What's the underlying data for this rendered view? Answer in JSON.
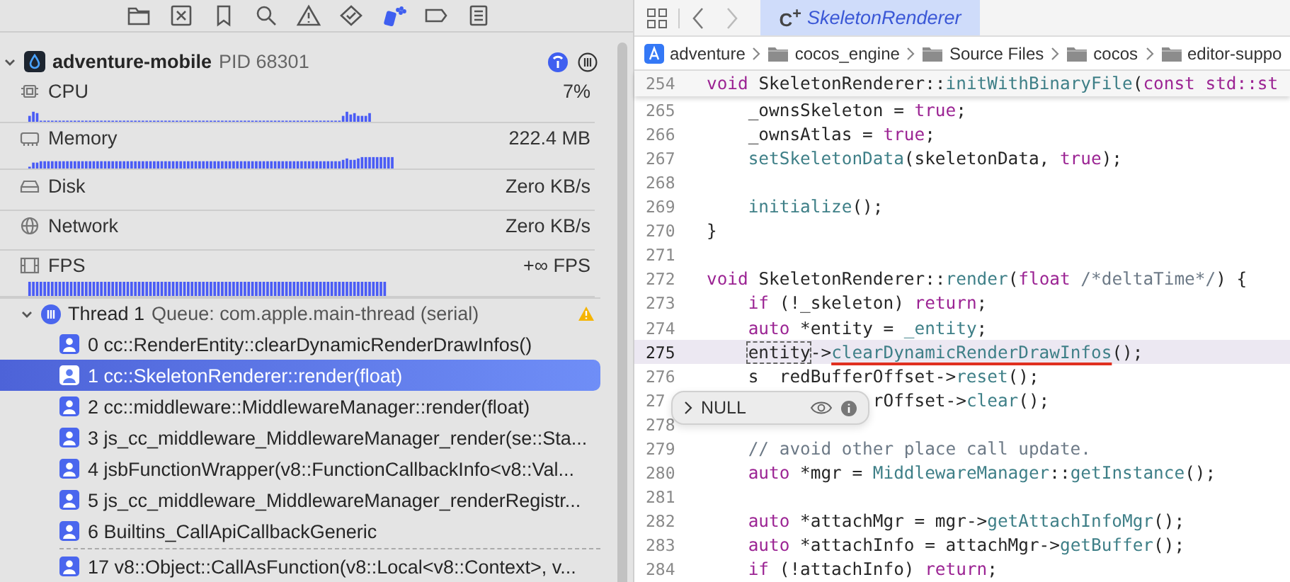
{
  "navigator_tabs": [
    {
      "selected": false
    },
    {
      "selected": false
    },
    {
      "selected": false
    },
    {
      "selected": false
    },
    {
      "selected": false
    },
    {
      "selected": false
    },
    {
      "selected": true
    },
    {
      "selected": false
    },
    {
      "selected": false
    }
  ],
  "process": {
    "name": "adventure-mobile",
    "pid": "PID 68301",
    "expanded": true
  },
  "gauges": [
    {
      "kind": "cpu",
      "label": "CPU",
      "value": "7%"
    },
    {
      "kind": "memory",
      "label": "Memory",
      "value": "222.4 MB"
    },
    {
      "kind": "disk",
      "label": "Disk",
      "value": "Zero KB/s"
    },
    {
      "kind": "network",
      "label": "Network",
      "value": "Zero KB/s"
    },
    {
      "kind": "fps",
      "label": "FPS",
      "value": "+∞ FPS"
    }
  ],
  "thread": {
    "title": "Thread 1",
    "queue": "Queue: com.apple.main-thread (serial)",
    "expanded": true,
    "warning": true
  },
  "frames": [
    {
      "text": "0 cc::RenderEntity::clearDynamicRenderDrawInfos()",
      "selected": false
    },
    {
      "text": "1 cc::SkeletonRenderer::render(float)",
      "selected": true
    },
    {
      "text": "2 cc::middleware::MiddlewareManager::render(float)",
      "selected": false
    },
    {
      "text": "3 js_cc_middleware_MiddlewareManager_render(se::Sta...",
      "selected": false
    },
    {
      "text": "4 jsbFunctionWrapper(v8::FunctionCallbackInfo<v8::Val...",
      "selected": false
    },
    {
      "text": "5 js_cc_middleware_MiddlewareManager_renderRegistr...",
      "selected": false
    },
    {
      "text": "6 Builtins_CallApiCallbackGeneric",
      "selected": false
    },
    {
      "text": "17 v8::Object::CallAsFunction(v8::Local<v8::Context>, v...",
      "selected": false,
      "gap_before": true
    }
  ],
  "editor_tab": {
    "file_type": "C$^{+}$",
    "label": "SkeletonRenderer",
    "selected": true
  },
  "breadcrumb": [
    {
      "kind": "project",
      "label": "adventure"
    },
    {
      "kind": "folder",
      "label": "cocos_engine"
    },
    {
      "kind": "folder",
      "label": "Source Files"
    },
    {
      "kind": "folder",
      "label": "cocos"
    },
    {
      "kind": "folder",
      "label": "editor-suppo"
    }
  ],
  "sticky_line": {
    "num": "254",
    "tokens": [
      {
        "t": "void",
        "kind": "keyword"
      },
      {
        "t": " SkeletonRenderer::",
        "kind": "plain"
      },
      {
        "t": "initWithBinaryFile",
        "kind": "function"
      },
      {
        "t": "(",
        "kind": "plain"
      },
      {
        "t": "const",
        "kind": "keyword"
      },
      {
        "t": " std::st",
        "kind": "keyword"
      }
    ]
  },
  "lines": [
    {
      "num": "265",
      "indented": true,
      "tokens": [
        {
          "t": "_ownsSkeleton = ",
          "kind": "plain"
        },
        {
          "t": "true",
          "kind": "keyword"
        },
        {
          "t": ";",
          "kind": "plain"
        }
      ]
    },
    {
      "num": "266",
      "indented": true,
      "tokens": [
        {
          "t": "_ownsAtlas = ",
          "kind": "plain"
        },
        {
          "t": "true",
          "kind": "keyword"
        },
        {
          "t": ";",
          "kind": "plain"
        }
      ]
    },
    {
      "num": "267",
      "indented": true,
      "tokens": [
        {
          "t": "setSkeletonData",
          "kind": "function"
        },
        {
          "t": "(skeletonData, ",
          "kind": "plain"
        },
        {
          "t": "true",
          "kind": "keyword"
        },
        {
          "t": ");",
          "kind": "plain"
        }
      ]
    },
    {
      "num": "268"
    },
    {
      "num": "269",
      "indented": true,
      "tokens": [
        {
          "t": "initialize",
          "kind": "function"
        },
        {
          "t": "();",
          "kind": "plain"
        }
      ]
    },
    {
      "num": "270",
      "indented": false,
      "tokens": [
        {
          "t": "}",
          "kind": "plain"
        }
      ]
    },
    {
      "num": "271"
    },
    {
      "num": "272",
      "indented": false,
      "tokens": [
        {
          "t": "void",
          "kind": "keyword"
        },
        {
          "t": " SkeletonRenderer::",
          "kind": "plain"
        },
        {
          "t": "render",
          "kind": "function"
        },
        {
          "t": "(",
          "kind": "plain"
        },
        {
          "t": "float",
          "kind": "keyword"
        },
        {
          "t": " /*deltaTime*/",
          "kind": "comment"
        },
        {
          "t": ") {",
          "kind": "plain"
        }
      ]
    },
    {
      "num": "273",
      "indented": true,
      "tokens": [
        {
          "t": "if",
          "kind": "keyword"
        },
        {
          "t": " (!_skeleton) ",
          "kind": "plain"
        },
        {
          "t": "return",
          "kind": "keyword"
        },
        {
          "t": ";",
          "kind": "plain"
        }
      ]
    },
    {
      "num": "274",
      "indented": true,
      "tokens": [
        {
          "t": "auto",
          "kind": "keyword"
        },
        {
          "t": " *entity = ",
          "kind": "plain"
        },
        {
          "t": "_entity",
          "kind": "function"
        },
        {
          "t": ";",
          "kind": "plain"
        }
      ]
    },
    {
      "num": "275",
      "current": true,
      "indented": true,
      "tokens": [
        {
          "t": "entity",
          "kind": "hovered"
        },
        {
          "t": "->",
          "kind": "plain"
        },
        {
          "t": "clearDynamicRenderDrawInfos",
          "kind": "function",
          "underline": true
        },
        {
          "t": "();",
          "kind": "plain"
        }
      ]
    },
    {
      "num": "276",
      "indented": true,
      "tokens": [
        {
          "t": "s  redBufferOffset->",
          "kind": "plain"
        },
        {
          "t": "reset",
          "kind": "function"
        },
        {
          "t": "();",
          "kind": "plain"
        }
      ]
    },
    {
      "num": "27",
      "indented": true,
      "under_popover": true,
      "tokens": [
        {
          "t": "rOffset->",
          "kind": "plain"
        },
        {
          "t": "clear",
          "kind": "function"
        },
        {
          "t": "();",
          "kind": "plain"
        }
      ]
    },
    {
      "num": "278"
    },
    {
      "num": "279",
      "indented": true,
      "tokens": [
        {
          "t": "// avoid other place call update.",
          "kind": "comment"
        }
      ]
    },
    {
      "num": "280",
      "indented": true,
      "tokens": [
        {
          "t": "auto",
          "kind": "keyword"
        },
        {
          "t": " *mgr = ",
          "kind": "plain"
        },
        {
          "t": "MiddlewareManager",
          "kind": "function"
        },
        {
          "t": "::",
          "kind": "plain"
        },
        {
          "t": "getInstance",
          "kind": "function"
        },
        {
          "t": "();",
          "kind": "plain"
        }
      ]
    },
    {
      "num": "281"
    },
    {
      "num": "282",
      "indented": true,
      "tokens": [
        {
          "t": "auto",
          "kind": "keyword"
        },
        {
          "t": " *attachMgr = mgr->",
          "kind": "plain"
        },
        {
          "t": "getAttachInfoMgr",
          "kind": "function"
        },
        {
          "t": "();",
          "kind": "plain"
        }
      ]
    },
    {
      "num": "283",
      "indented": true,
      "tokens": [
        {
          "t": "auto",
          "kind": "keyword"
        },
        {
          "t": " *attachInfo = attachMgr->",
          "kind": "plain"
        },
        {
          "t": "getBuffer",
          "kind": "function"
        },
        {
          "t": "();",
          "kind": "plain"
        }
      ]
    },
    {
      "num": "284",
      "indented": true,
      "tokens": [
        {
          "t": "if",
          "kind": "keyword"
        },
        {
          "t": " (!attachInfo) ",
          "kind": "plain"
        },
        {
          "t": "return",
          "kind": "keyword"
        },
        {
          "t": ";",
          "kind": "plain"
        }
      ]
    }
  ],
  "popover": {
    "value": "NULL"
  }
}
